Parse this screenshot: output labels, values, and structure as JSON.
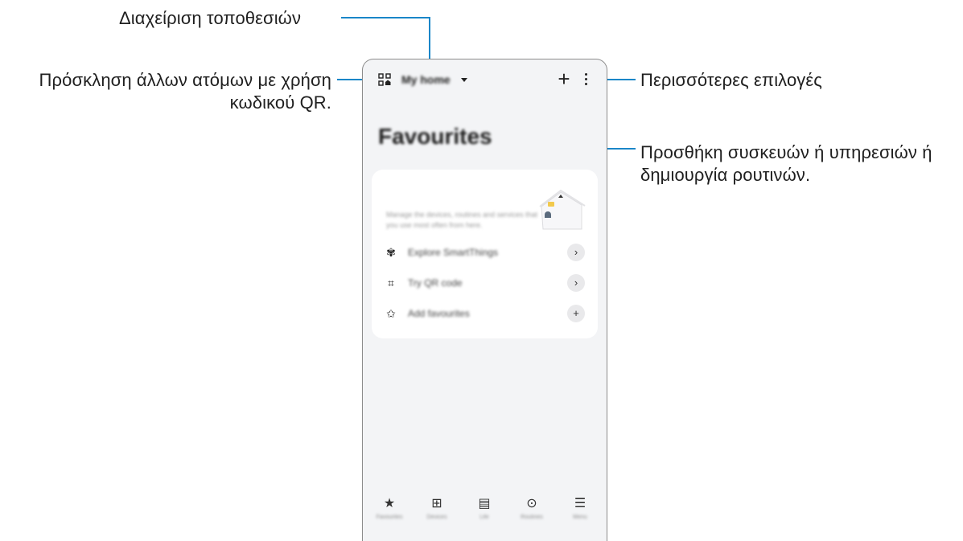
{
  "callouts": {
    "manage_locations": "Διαχείριση τοποθεσιών",
    "invite_line1": "Πρόσκληση άλλων ατόμων με χρήση",
    "invite_line2": "κωδικού QR.",
    "more_options": "Περισσότερες επιλογές",
    "add_line1": "Προσθήκη συσκευών ή υπηρεσιών ή",
    "add_line2": "δημιουργία ρουτινών."
  },
  "phone": {
    "topbar": {
      "location_name": "My home",
      "add_symbol": "+"
    },
    "page_title": "Favourites",
    "card": {
      "description": "Manage the devices, routines and services that you use most often from here.",
      "rows": [
        {
          "label": "Explore SmartThings",
          "icon": "devices-icon",
          "glyph": "✾",
          "action": "›"
        },
        {
          "label": "Try QR code",
          "icon": "qr-home-icon",
          "glyph": "⌗",
          "action": "›"
        },
        {
          "label": "Add favourites",
          "icon": "star-outline-icon",
          "glyph": "✩",
          "action": "+"
        }
      ]
    },
    "bottom_nav": [
      {
        "label": "Favourites",
        "icon": "star-icon",
        "glyph": "★"
      },
      {
        "label": "Devices",
        "icon": "grid-icon",
        "glyph": "⊞"
      },
      {
        "label": "Life",
        "icon": "notes-icon",
        "glyph": "▤"
      },
      {
        "label": "Routines",
        "icon": "play-circle-icon",
        "glyph": "⊙"
      },
      {
        "label": "Menu",
        "icon": "menu-icon",
        "glyph": "☰"
      }
    ]
  },
  "colors": {
    "callout_line": "#1a86c8",
    "phone_background": "#f3f4f6",
    "card_background": "#ffffff"
  }
}
